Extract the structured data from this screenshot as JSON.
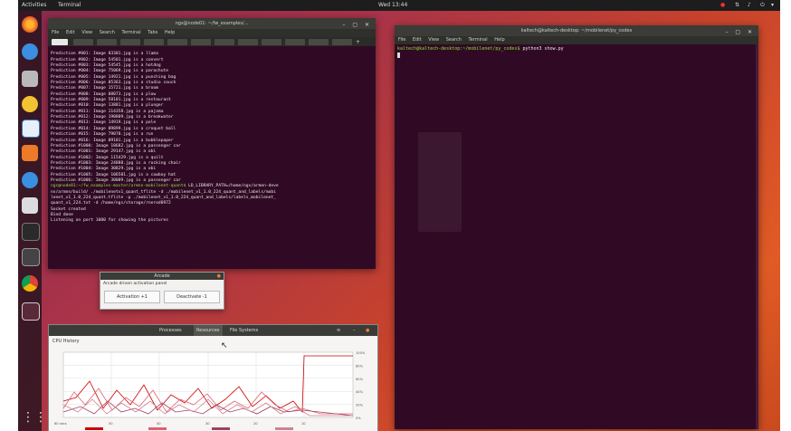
{
  "topbar": {
    "activities": "Activities",
    "app_menu": "Terminal",
    "clock": "Wed 13:44"
  },
  "dock": {
    "icons": [
      "firefox-icon",
      "thunderbird-icon",
      "files-icon",
      "rhythmbox-icon",
      "writer-icon",
      "software-icon",
      "help-icon",
      "amazon-icon",
      "terminal-icon",
      "monitor-icon",
      "chrome-icon",
      "screenshot-icon",
      "apps-grid-icon"
    ]
  },
  "left_terminal": {
    "title": "ngs@node01: ~/fw_examples/...",
    "menu": [
      "File",
      "Edit",
      "View",
      "Search",
      "Terminal",
      "Tabs",
      "Help"
    ],
    "lines": [
      "Prediction #001: Image 03301.jpg is a llama",
      "Prediction #002: Image 54501.jpg is a convert",
      "Prediction #003: Image 54545.jpg is a hotdog",
      "Prediction #004: Image 75069.jpg is a parachute",
      "Prediction #005: Image 14921.jpg is a punching bag",
      "Prediction #006: Image 05363.jpg is a studio couch",
      "Prediction #007: Image 15721.jpg is a broom",
      "Prediction #008: Image 08073.jpg is a plow",
      "Prediction #009: Image 58101.jpg is a restaurant",
      "Prediction #010: Image 13881.jpg is a plunger",
      "Prediction #011: Image 114358.jpg is a pajama",
      "Prediction #012: Image 190809.jpg is a breakwater",
      "Prediction #013: Image 14919.jpg is a pole",
      "Prediction #014: Image 09899.jpg is a croquet ball",
      "Prediction #015: Image 79078.jpg is a run",
      "Prediction #016: Image 09101.jpg is a bubblepaper",
      "Prediction #1000: Image 18682.jpg is a passenger car",
      "Prediction #1001: Image 29147.jpg is a obi",
      "Prediction #1002: Image 115429.jpg is a quilt",
      "Prediction #1003: Image 24888.jpg is a rocking chair",
      "Prediction #1004: Image 30829.jpg is a obi",
      "Prediction #1005: Image 106501.jpg is a cowboy hat",
      "Prediction #1006: Image 30009.jpg is a passenger car"
    ],
    "cmd_prompt": "ngs@node01:~/fw_examples-master/armnn-mobilenet-quant$",
    "cmd_lines": [
      " LD_LIBRARY_PATH=/home/ngs/armnn-deve",
      "nv/armnn/build/ ./mobilenetv1_quant_tflite -d ./mobilenet_v1_1.0_224_quant_and_labels/mobi",
      "lenet_v1_1.0_224_quant.tflite -p ./mobilenet_v1_1.0_224_quant_and_labels/labels_mobilenet_",
      "quant_v1_224.txt -d /home/ngs/storage/rnerod8972"
    ],
    "status": [
      "Socket created",
      "Bind done",
      "Listening on port 1000 for showing the pictures"
    ]
  },
  "right_terminal": {
    "title": "kaltech@kaltech-desktop: ~/mobilenet/py_codes",
    "menu": [
      "File",
      "Edit",
      "View",
      "Search",
      "Terminal",
      "Help"
    ],
    "prompt": "kaltech@kaltech-desktop:~/mobilenet/py_codes$",
    "command": " python3 show.py"
  },
  "small_dialog": {
    "title": "Arcade",
    "label": "Arcade driven activation panel",
    "left_button": "Activation +1",
    "right_button": "Deactivate -1"
  },
  "system_monitor": {
    "tabs": [
      "Processes",
      "Resources",
      "File Systems"
    ],
    "active_tab": "Resources",
    "section_title": "CPU History",
    "y_ticks": [
      "100%",
      "80%",
      "60%",
      "40%",
      "20%",
      "0%"
    ],
    "x_ticks": [
      "60 secs",
      "50",
      "40",
      "30",
      "20",
      "10"
    ]
  }
}
